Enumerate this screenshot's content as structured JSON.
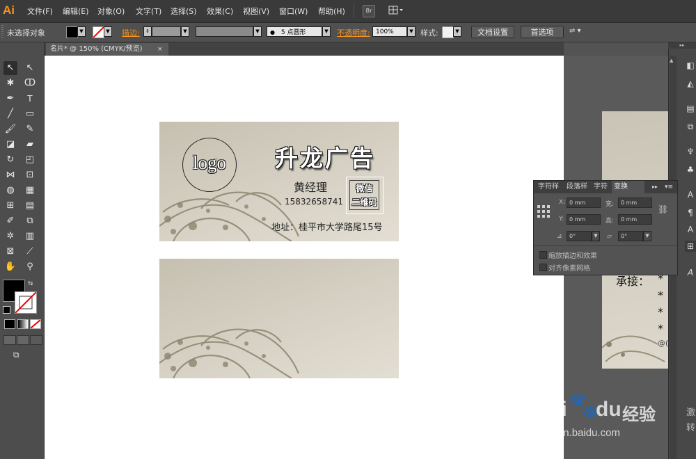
{
  "app": {
    "logo": "Ai"
  },
  "menu": [
    "文件(F)",
    "编辑(E)",
    "对象(O)",
    "文字(T)",
    "选择(S)",
    "效果(C)",
    "视图(V)",
    "窗口(W)",
    "帮助(H)"
  ],
  "menu_bridge_label": "Br",
  "control": {
    "no_selection": "未选择对象",
    "stroke_label": "描边:",
    "brush_size": "5 点圆形",
    "opacity_label": "不透明度:",
    "opacity_value": "100%",
    "style_label": "样式:",
    "doc_settings": "文档设置",
    "preferences": "首选项"
  },
  "document_tab": {
    "title": "名片* @ 150% (CMYK/预览)",
    "close": "×"
  },
  "card_front": {
    "logo_text": "logo",
    "company": "升龙广告",
    "name": "黄经理",
    "phone": "15832658741",
    "qr_line1": "微信",
    "qr_line2": "二维码",
    "address": "地址：桂平市大学路尾15号"
  },
  "right_card": {
    "partial_text": "承接：",
    "star": "*",
    "at": "@("
  },
  "panel": {
    "tabs": [
      "字符样",
      "段落样",
      "字符",
      "变换"
    ],
    "x_label": "X:",
    "x_value": "0 mm",
    "w_label": "宽:",
    "w_value": "0 mm",
    "y_label": "Y:",
    "y_value": "0 mm",
    "h_label": "高:",
    "h_value": "0 mm",
    "rotate_value": "0°",
    "shear_value": "0°",
    "scale_strokes": "缩放描边和效果",
    "align_pixel": "对齐像素网格"
  },
  "watermark": {
    "brand": "Bai",
    "brand2": "du",
    "product": "经验",
    "url": "jingyan.baidu.com"
  },
  "right_edge_text": [
    "激",
    "转"
  ],
  "colors": {
    "accent": "#f7931e",
    "chrome": "#3a3a3a",
    "card": "#cfc9bb",
    "swirl": "#8c8570"
  }
}
